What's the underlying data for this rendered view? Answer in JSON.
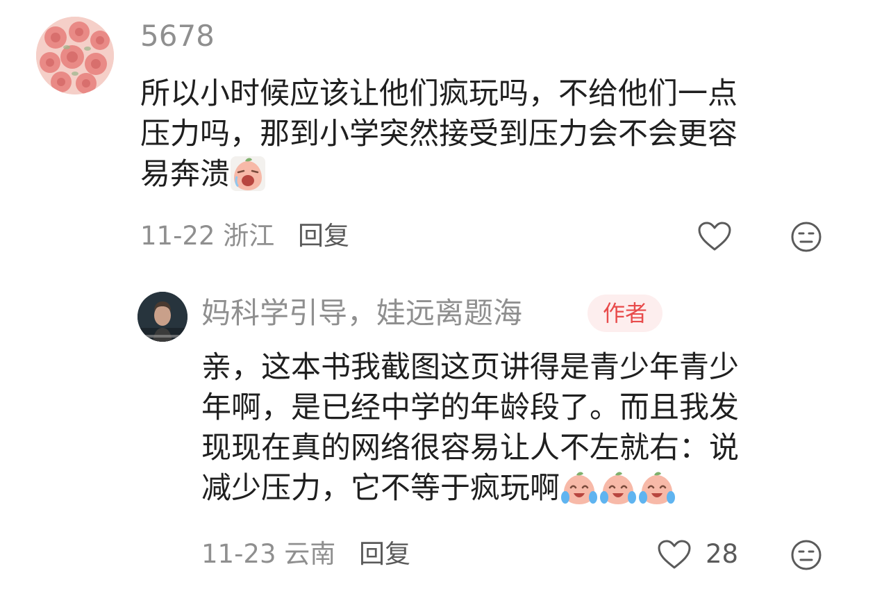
{
  "comments": [
    {
      "username": "5678",
      "avatar_icon": "rose-bouquet-avatar",
      "text_lines": [
        "所以小时候应该让他们疯玩吗，不给他们一点",
        "压力吗，那到小学突然接受到压力会不会更容",
        "易奔溃"
      ],
      "emoji": [
        "crying-peach-emoji"
      ],
      "date": "11-22",
      "location": "浙江",
      "reply_label": "回复",
      "like_icon": "heart-outline-icon",
      "dislike_icon": "meh-face-icon"
    },
    {
      "username": "妈科学引导，娃远离题海",
      "badge": "作者",
      "avatar_icon": "man-portrait-avatar",
      "text_lines": [
        "亲，这本书我截图这页讲得是青少年青少",
        "年啊，是已经中学的年龄段了。而且我发",
        "现现在真的网络很容易让人不左就右：说",
        "减少压力，它不等于疯玩啊"
      ],
      "emoji": [
        "tearful-peach-emoji",
        "tearful-peach-emoji",
        "tearful-peach-emoji"
      ],
      "date": "11-23",
      "location": "云南",
      "reply_label": "回复",
      "like_count": "28",
      "like_icon": "heart-outline-icon",
      "dislike_icon": "meh-face-icon"
    }
  ],
  "colors": {
    "username": "#8f8f8f",
    "text": "#1f1f1f",
    "badge_bg": "#fdeeee",
    "badge_text": "#e84b4b"
  }
}
